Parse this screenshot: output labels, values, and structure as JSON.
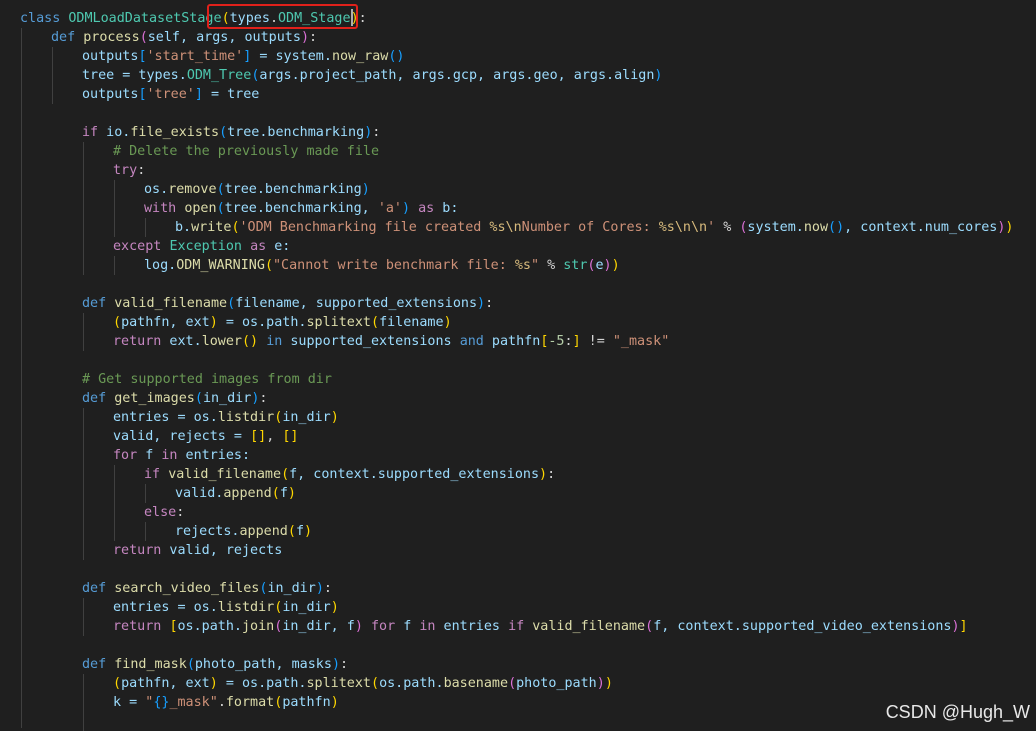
{
  "code": {
    "l1": {
      "kw": "class",
      "name": "ODMLoadDatasetStage",
      "p1": "(",
      "types": "types",
      "dot": ".",
      "base": "ODM_Stage",
      "p2": ")",
      "colon": ":"
    },
    "l2": {
      "kw": "def",
      "name": "process",
      "p1": "(",
      "args": "self, args, outputs",
      "p2": ")",
      "colon": ":"
    },
    "l3": {
      "a": "outputs",
      "b1": "[",
      "s": "'start_time'",
      "b2": "]",
      "eq": " = system.",
      "fn": "now_raw",
      "p": "()"
    },
    "l4": {
      "a": "tree = types.",
      "fn": "ODM_Tree",
      "p1": "(",
      "args": "args.project_path, args.gcp, args.geo, args.align",
      "p2": ")"
    },
    "l5": {
      "a": "outputs",
      "b1": "[",
      "s": "'tree'",
      "b2": "]",
      "eq": " = tree"
    },
    "l7": {
      "kw": "if",
      "a": " io.",
      "fn": "file_exists",
      "p1": "(",
      "args": "tree.benchmarking",
      "p2": ")",
      "colon": ":"
    },
    "l8": {
      "cmt": "# Delete the previously made file"
    },
    "l9": {
      "kw": "try",
      "colon": ":"
    },
    "l10": {
      "a": "os.",
      "fn": "remove",
      "p1": "(",
      "args": "tree.benchmarking",
      "p2": ")"
    },
    "l11": {
      "kw": "with",
      "fn": "open",
      "p1": "(",
      "args": "tree.benchmarking, ",
      "s": "'a'",
      "p2": ")",
      "as": "as",
      "rest": " b:"
    },
    "l12": {
      "a": "b.",
      "fn": "write",
      "p1": "(",
      "s1": "'ODM Benchmarking file created ",
      "e1": "%s\\n",
      "s2": "Number of Cores: ",
      "e2": "%s\\n\\n",
      "s3": "'",
      "mod": " % ",
      "p3": "(",
      "b": "system.",
      "fn2": "now",
      "p4": "()",
      "c": ", context.num_cores",
      "p5": ")",
      "p2": ")"
    },
    "l13": {
      "kw": "except",
      "cls": "Exception",
      "as": "as",
      "rest": " e:"
    },
    "l14": {
      "a": "log.",
      "fn": "ODM_WARNING",
      "p1": "(",
      "s1": "\"Cannot write benchmark file: ",
      "e1": "%s",
      "s2": "\"",
      "mod": " % ",
      "fn2": "str",
      "p3": "(",
      "b": "e",
      "p4": ")",
      "p2": ")"
    },
    "l16": {
      "kw": "def",
      "name": "valid_filename",
      "p1": "(",
      "args": "filename, supported_extensions",
      "p2": ")",
      "colon": ":"
    },
    "l17": {
      "p1": "(",
      "a": "pathfn, ext",
      "p2": ")",
      "eq": " = os.path.",
      "fn": "splitext",
      "p3": "(",
      "b": "filename",
      "p4": ")"
    },
    "l18": {
      "kw": "return",
      "a": " ext.",
      "fn": "lower",
      "p1": "()",
      "kw2": "in",
      "b": " supported_extensions ",
      "kw3": "and",
      "c": " pathfn",
      "b1": "[",
      "n": "-5",
      "c2": ":",
      "b2": "]",
      "d": " != ",
      "s": "\"_mask\""
    },
    "l20": {
      "cmt": "# Get supported images from dir"
    },
    "l21": {
      "kw": "def",
      "name": "get_images",
      "p1": "(",
      "args": "in_dir",
      "p2": ")",
      "colon": ":"
    },
    "l22": {
      "a": "entries = os.",
      "fn": "listdir",
      "p1": "(",
      "args": "in_dir",
      "p2": ")"
    },
    "l23": {
      "a": "valid, rejects = ",
      "b1": "[]",
      "c": ", ",
      "b2": "[]"
    },
    "l24": {
      "kw": "for",
      "a": " f ",
      "kw2": "in",
      "b": " entries:"
    },
    "l25": {
      "kw": "if",
      "fn": "valid_filename",
      "p1": "(",
      "args": "f, context.supported_extensions",
      "p2": ")",
      "colon": ":"
    },
    "l26": {
      "a": "valid.",
      "fn": "append",
      "p1": "(",
      "args": "f",
      "p2": ")"
    },
    "l27": {
      "kw": "else",
      "colon": ":"
    },
    "l28": {
      "a": "rejects.",
      "fn": "append",
      "p1": "(",
      "args": "f",
      "p2": ")"
    },
    "l29": {
      "kw": "return",
      "a": " valid, rejects"
    },
    "l31": {
      "kw": "def",
      "name": "search_video_files",
      "p1": "(",
      "args": "in_dir",
      "p2": ")",
      "colon": ":"
    },
    "l32": {
      "a": "entries = os.",
      "fn": "listdir",
      "p1": "(",
      "args": "in_dir",
      "p2": ")"
    },
    "l33": {
      "kw": "return",
      "b1": "[",
      "a": "os.path.",
      "fn": "join",
      "p1": "(",
      "args": "in_dir, f",
      "p2": ")",
      "kw2": "for",
      "b": " f ",
      "kw3": "in",
      "c": " entries ",
      "kw4": "if",
      "fn2": "valid_filename",
      "p3": "(",
      "args2": "f, context.supported_video_extensions",
      "p4": ")",
      "b2": "]"
    },
    "l35": {
      "kw": "def",
      "name": "find_mask",
      "p1": "(",
      "args": "photo_path, masks",
      "p2": ")",
      "colon": ":"
    },
    "l36": {
      "p1": "(",
      "a": "pathfn, ext",
      "p2": ")",
      "eq": " = os.path.",
      "fn": "splitext",
      "p3": "(",
      "b": "os.path.",
      "fn2": "basename",
      "p4": "(",
      "c": "photo_path",
      "p5": ")",
      "p6": ")"
    },
    "l37": {
      "a": "k = ",
      "s1": "\"",
      "e": "{}",
      "s2": "_mask\"",
      "b": ".",
      "fn": "format",
      "p1": "(",
      "args": "pathfn",
      "p2": ")"
    }
  },
  "watermark": "CSDN @Hugh_W"
}
